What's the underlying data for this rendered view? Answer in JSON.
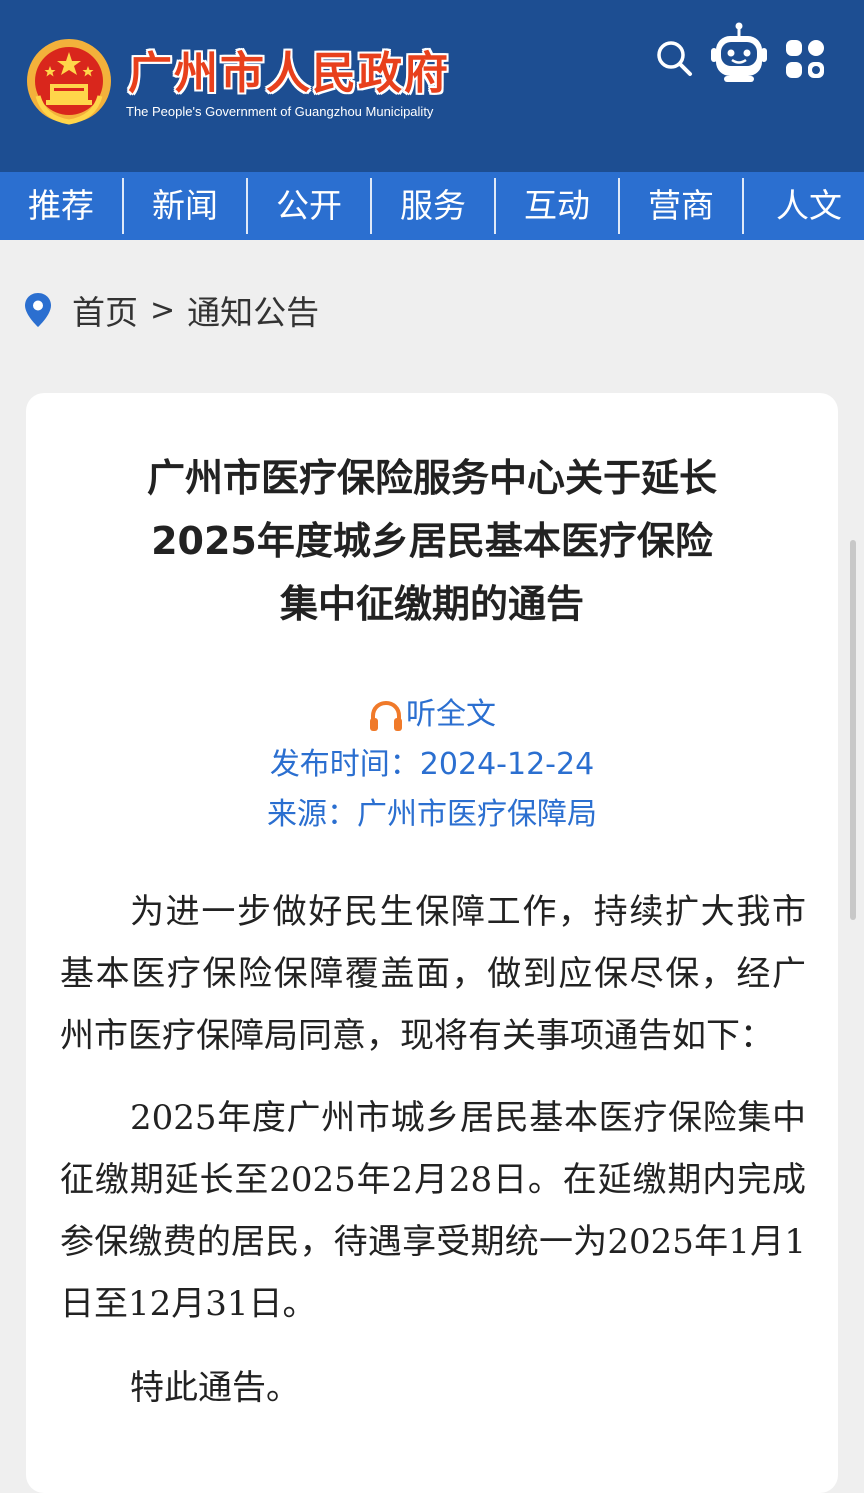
{
  "header": {
    "title": "广州市人民政府",
    "subtitle": "The People's Government of Guangzhou Municipality",
    "icons": [
      "emblem-icon",
      "search-icon",
      "robot-assistant-icon",
      "apps-grid-icon"
    ]
  },
  "nav": {
    "items": [
      {
        "label": "推荐"
      },
      {
        "label": "新闻"
      },
      {
        "label": "公开"
      },
      {
        "label": "服务"
      },
      {
        "label": "互动"
      },
      {
        "label": "营商"
      },
      {
        "label": "人文"
      }
    ]
  },
  "breadcrumb": {
    "home": "首页",
    "separator": ">",
    "current": "通知公告"
  },
  "article": {
    "title_lines": [
      "广州市医疗保险服务中心关于延长",
      "2025年度城乡居民基本医疗保险",
      "集中征缴期的通告"
    ],
    "listen_label": "听全文",
    "date_text": "发布时间：2024-12-24",
    "source_text": "来源：广州市医疗保障局",
    "paragraphs": [
      "为进一步做好民生保障工作，持续扩大我市基本医疗保险保障覆盖面，做到应保尽保，经广州市医疗保障局同意，现将有关事项通告如下：",
      "2025年度广州市城乡居民基本医疗保险集中征缴期延长至2025年2月28日。在延缴期内完成参保缴费的居民，待遇享受期统一为2025年1月1日至12月31日。",
      "特此通告。"
    ]
  },
  "colors": {
    "header_bg": "#1d4e92",
    "nav_bg": "#2b6fd0",
    "title_red": "#e8401c",
    "meta_blue": "#2b6fd0",
    "headphone_orange": "#f07a2a"
  }
}
